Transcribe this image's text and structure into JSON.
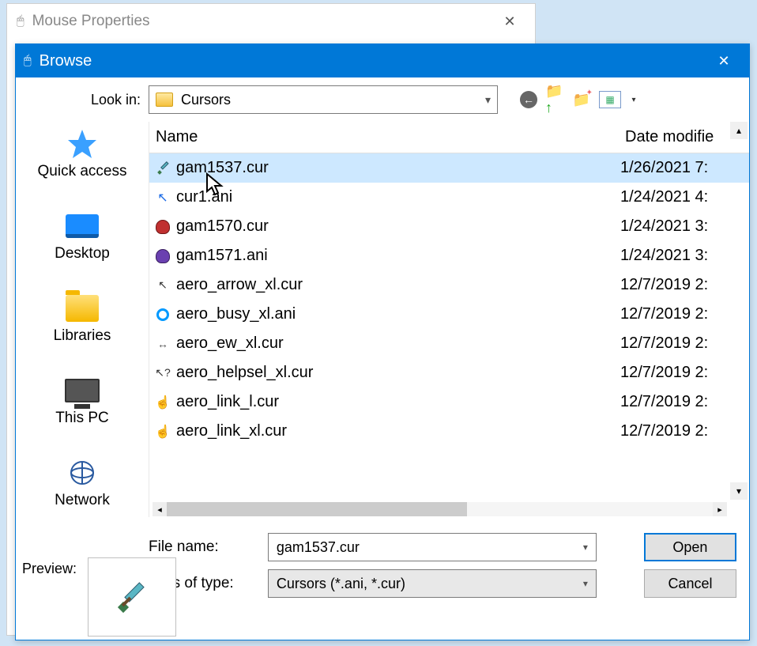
{
  "parent": {
    "title": "Mouse Properties"
  },
  "browse": {
    "title": "Browse"
  },
  "toolbar": {
    "look_in_label": "Look in:",
    "look_in_value": "Cursors"
  },
  "places": {
    "quick_access": "Quick access",
    "desktop": "Desktop",
    "libraries": "Libraries",
    "this_pc": "This PC",
    "network": "Network"
  },
  "columns": {
    "name": "Name",
    "date": "Date modifie"
  },
  "files": [
    {
      "name": "gam1537.cur",
      "date": "1/26/2021 7:",
      "icon": "sword",
      "selected": true
    },
    {
      "name": "cur1.ani",
      "date": "1/24/2021 4:",
      "icon": "bluecursor"
    },
    {
      "name": "gam1570.cur",
      "date": "1/24/2021 3:",
      "icon": "among-red"
    },
    {
      "name": "gam1571.ani",
      "date": "1/24/2021 3:",
      "icon": "among-purple"
    },
    {
      "name": "aero_arrow_xl.cur",
      "date": "12/7/2019 2:",
      "icon": "arrow"
    },
    {
      "name": "aero_busy_xl.ani",
      "date": "12/7/2019 2:",
      "icon": "busy"
    },
    {
      "name": "aero_ew_xl.cur",
      "date": "12/7/2019 2:",
      "icon": "ew"
    },
    {
      "name": "aero_helpsel_xl.cur",
      "date": "12/7/2019 2:",
      "icon": "help"
    },
    {
      "name": "aero_link_l.cur",
      "date": "12/7/2019 2:",
      "icon": "link"
    },
    {
      "name": "aero_link_xl.cur",
      "date": "12/7/2019 2:",
      "icon": "link"
    }
  ],
  "fields": {
    "file_name_label": "File name:",
    "file_name_value": "gam1537.cur",
    "files_of_type_label": "Files of type:",
    "files_of_type_value": "Cursors (*.ani, *.cur)"
  },
  "buttons": {
    "open": "Open",
    "cancel": "Cancel"
  },
  "preview": {
    "label": "Preview:"
  }
}
